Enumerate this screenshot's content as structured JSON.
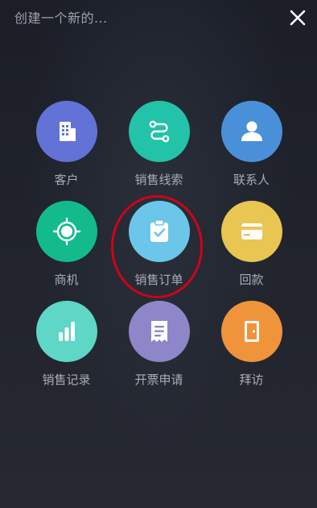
{
  "header": {
    "title": "创建一个新的..."
  },
  "items": [
    {
      "label": "客户",
      "icon": "building-icon",
      "color": "#6272d6"
    },
    {
      "label": "销售线索",
      "icon": "route-icon",
      "color": "#22c3a8"
    },
    {
      "label": "联系人",
      "icon": "person-icon",
      "color": "#4a90d9"
    },
    {
      "label": "商机",
      "icon": "target-icon",
      "color": "#13bb8c"
    },
    {
      "label": "销售订单",
      "icon": "clipboard-check-icon",
      "color": "#6cc6ea"
    },
    {
      "label": "回款",
      "icon": "card-icon",
      "color": "#e9c552"
    },
    {
      "label": "销售记录",
      "icon": "bar-chart-icon",
      "color": "#5ed7c6"
    },
    {
      "label": "开票申请",
      "icon": "receipt-icon",
      "color": "#8d86c9"
    },
    {
      "label": "拜访",
      "icon": "door-icon",
      "color": "#ef943a"
    }
  ],
  "highlight": {
    "target": "销售订单",
    "color": "#d0021b"
  }
}
